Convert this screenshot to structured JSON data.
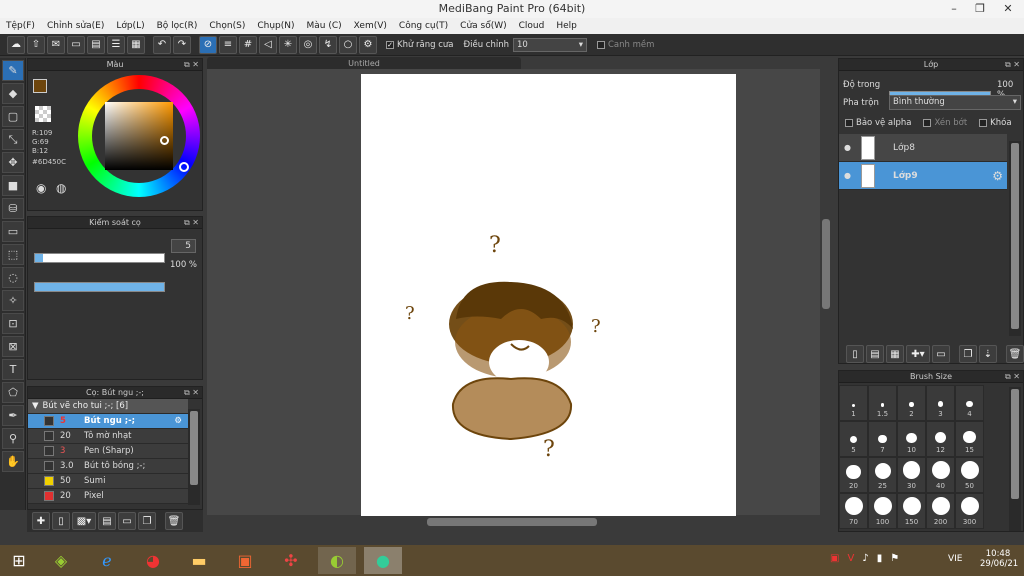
{
  "window": {
    "title": "MediBang Paint Pro (64bit)"
  },
  "menu": [
    "Tệp(F)",
    "Chỉnh sửa(E)",
    "Lớp(L)",
    "Bộ lọc(R)",
    "Chọn(S)",
    "Chụp(N)",
    "Màu (C)",
    "Xem(V)",
    "Công cụ(T)",
    "Cửa sổ(W)",
    "Cloud",
    "Help"
  ],
  "toolbar": {
    "antialias_label": "Khử răng cưa",
    "correction_label": "Điều chỉnh",
    "correction_value": "10",
    "snap_label": "Canh mềm"
  },
  "color_panel": {
    "title": "Màu",
    "r": "R:109",
    "g": "G:69",
    "b": "B:12",
    "hex": "#6D450C",
    "fg_color": "#6D450C"
  },
  "brush_control": {
    "title": "Kiểm soát cọ",
    "size_value": "5",
    "size_fraction": 0.06,
    "opacity_value": "100 %",
    "opacity_fraction": 1.0
  },
  "brush_panel": {
    "title": "Cọ: Bút ngu ;-;",
    "group": "Bút vẽ cho tui ;-; [6]",
    "items": [
      {
        "size": "5",
        "name": "Bút ngu ;-;",
        "color": "#333333",
        "selected": true
      },
      {
        "size": "20",
        "name": "Tô mờ nhạt",
        "color": "#333333",
        "selected": false
      },
      {
        "size": "3",
        "name": "Pen (Sharp)",
        "color": "#333333",
        "selected": false
      },
      {
        "size": "3.0",
        "name": "Bút tô bóng ;-;",
        "color": "#333333",
        "selected": false
      },
      {
        "size": "50",
        "name": "Sumi",
        "color": "#f0d000",
        "selected": false
      },
      {
        "size": "20",
        "name": "Pixel",
        "color": "#e03030",
        "selected": false
      }
    ]
  },
  "canvas": {
    "tab": "Untitled"
  },
  "layer_panel": {
    "title": "Lớp",
    "opacity_label": "Độ trong",
    "opacity_value": "100 %",
    "opacity_fraction": 1.0,
    "blend_label": "Pha trộn",
    "blend_value": "Bình thường",
    "protect_alpha": "Bảo vệ alpha",
    "clipping": "Xén bớt",
    "lock": "Khóa",
    "layers": [
      {
        "name": "Lớp8",
        "selected": false
      },
      {
        "name": "Lớp9",
        "selected": true
      }
    ]
  },
  "brush_size_panel": {
    "title": "Brush Size",
    "sizes": [
      "1",
      "1.5",
      "2",
      "3",
      "4",
      "5",
      "7",
      "10",
      "12",
      "15",
      "20",
      "25",
      "30",
      "40",
      "50",
      "70",
      "100",
      "150",
      "200",
      "300"
    ]
  },
  "taskbar": {
    "lang": "VIE",
    "time": "10:48",
    "date": "29/06/21"
  }
}
